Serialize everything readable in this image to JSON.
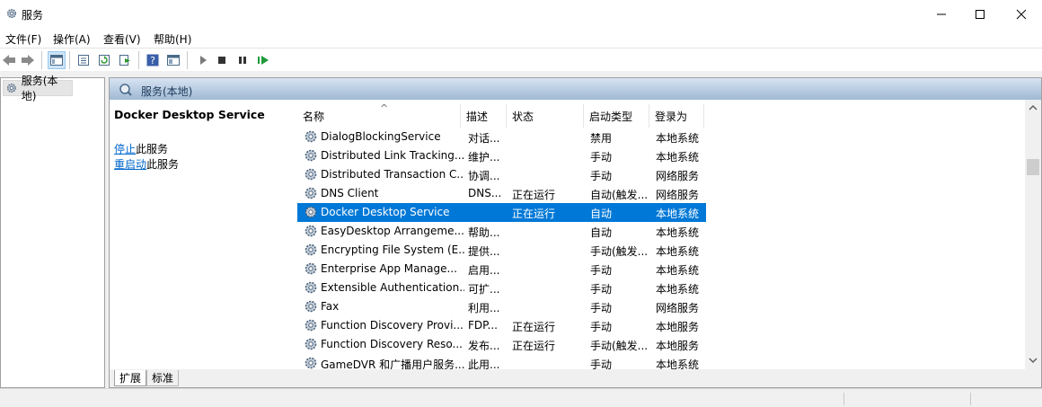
{
  "window": {
    "title": "服务",
    "minimize_icon": "minimize-icon",
    "maximize_icon": "maximize-icon",
    "close_icon": "close-icon"
  },
  "menu": {
    "items": [
      "文件(F)",
      "操作(A)",
      "查看(V)",
      "帮助(H)"
    ]
  },
  "toolbar": {
    "icons": [
      "back-icon",
      "forward-icon",
      "show-tree-icon",
      "properties-icon",
      "refresh-icon",
      "export-icon",
      "help-icon",
      "show-console-icon",
      "play-icon",
      "stop-icon",
      "pause-icon",
      "resume-icon"
    ]
  },
  "tree": {
    "root_label": "服务(本地)"
  },
  "pane": {
    "header": "服务(本地)"
  },
  "description": {
    "service_name": "Docker Desktop Service",
    "stop_link": "停止",
    "stop_suffix": "此服务",
    "restart_link": "重启动",
    "restart_suffix": "此服务"
  },
  "columns": {
    "name": "名称",
    "desc": "描述",
    "status": "状态",
    "startup": "启动类型",
    "logon": "登录为"
  },
  "rows": [
    {
      "name": "DialogBlockingService",
      "desc": "对话...",
      "status": "",
      "startup": "禁用",
      "logon": "本地系统"
    },
    {
      "name": "Distributed Link Tracking...",
      "desc": "维护...",
      "status": "",
      "startup": "手动",
      "logon": "本地系统"
    },
    {
      "name": "Distributed Transaction C...",
      "desc": "协调...",
      "status": "",
      "startup": "手动",
      "logon": "网络服务"
    },
    {
      "name": "DNS Client",
      "desc": "DNS...",
      "status": "正在运行",
      "startup": "自动(触发...",
      "logon": "网络服务"
    },
    {
      "name": "Docker Desktop Service",
      "desc": "",
      "status": "正在运行",
      "startup": "自动",
      "logon": "本地系统",
      "selected": true
    },
    {
      "name": "EasyDesktop Arrangeme...",
      "desc": "帮助...",
      "status": "",
      "startup": "自动",
      "logon": "本地系统"
    },
    {
      "name": "Encrypting File System (E...",
      "desc": "提供...",
      "status": "",
      "startup": "手动(触发...",
      "logon": "本地系统"
    },
    {
      "name": "Enterprise App Manage...",
      "desc": "启用...",
      "status": "",
      "startup": "手动",
      "logon": "本地系统"
    },
    {
      "name": "Extensible Authentication...",
      "desc": "可扩...",
      "status": "",
      "startup": "手动",
      "logon": "本地系统"
    },
    {
      "name": "Fax",
      "desc": "利用...",
      "status": "",
      "startup": "手动",
      "logon": "网络服务"
    },
    {
      "name": "Function Discovery Provi...",
      "desc": "FDP...",
      "status": "正在运行",
      "startup": "手动",
      "logon": "本地服务"
    },
    {
      "name": "Function Discovery Reso...",
      "desc": "发布...",
      "status": "正在运行",
      "startup": "手动(触发...",
      "logon": "本地服务"
    },
    {
      "name": "GameDVR 和广播用户服务...",
      "desc": "此用...",
      "status": "",
      "startup": "手动",
      "logon": "本地系统"
    }
  ],
  "tabs": {
    "extended": "扩展",
    "standard": "标准"
  },
  "colors": {
    "selection": "#0078d7",
    "link": "#0066cc",
    "header_top": "#d7e4f2",
    "header_bottom": "#9fb9d3"
  }
}
